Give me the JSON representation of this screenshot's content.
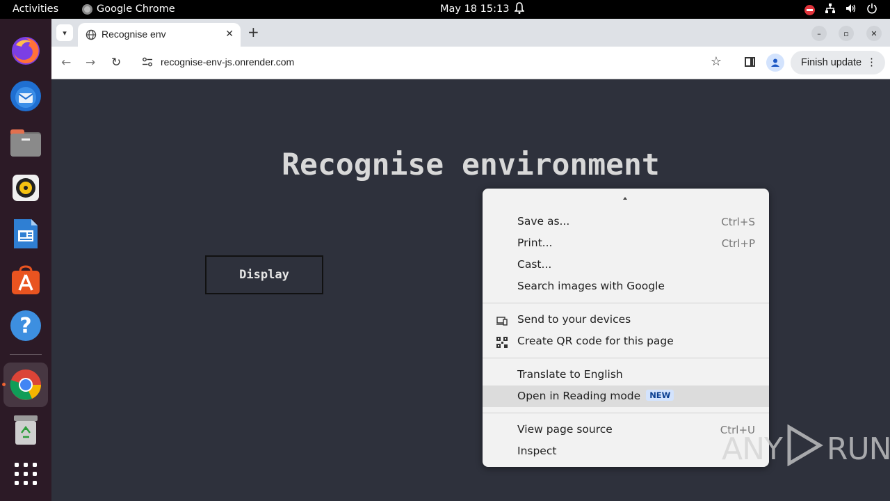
{
  "topbar": {
    "activities": "Activities",
    "app_name": "Google Chrome",
    "clock": "May 18  15:13"
  },
  "dock": {
    "items": [
      "firefox-icon",
      "thunderbird-icon",
      "files-icon",
      "rhythmbox-icon",
      "libreoffice-writer-icon",
      "app-center-icon",
      "help-icon",
      "chrome-icon",
      "trash-icon",
      "app-grid-icon"
    ]
  },
  "browser": {
    "tab": {
      "title": "Recognise env",
      "close": "✕"
    },
    "new_tab": "+",
    "url": "recognise-env-js.onrender.com",
    "update_button": "Finish update",
    "window_controls": {
      "minimize": "–",
      "maximize": "▫",
      "close": "✕"
    }
  },
  "page": {
    "heading": "Recognise environment",
    "button": "Display"
  },
  "context_menu": {
    "groups": [
      [
        {
          "label": "Save as...",
          "shortcut": "Ctrl+S"
        },
        {
          "label": "Print...",
          "shortcut": "Ctrl+P"
        },
        {
          "label": "Cast..."
        },
        {
          "label": "Search images with Google"
        }
      ],
      [
        {
          "label": "Send to your devices",
          "icon": "devices-icon"
        },
        {
          "label": "Create QR code for this page",
          "icon": "qr-code-icon"
        }
      ],
      [
        {
          "label": "Translate to English"
        },
        {
          "label": "Open in Reading mode",
          "badge": "NEW",
          "highlighted": true
        }
      ],
      [
        {
          "label": "View page source",
          "shortcut": "Ctrl+U"
        },
        {
          "label": "Inspect"
        }
      ]
    ]
  },
  "watermark": {
    "text_left": "ANY",
    "text_right": "RUN"
  },
  "colors": {
    "page_background": "#2e313c",
    "dock_background": "#2c1a26",
    "accent_orange": "#e95420"
  }
}
